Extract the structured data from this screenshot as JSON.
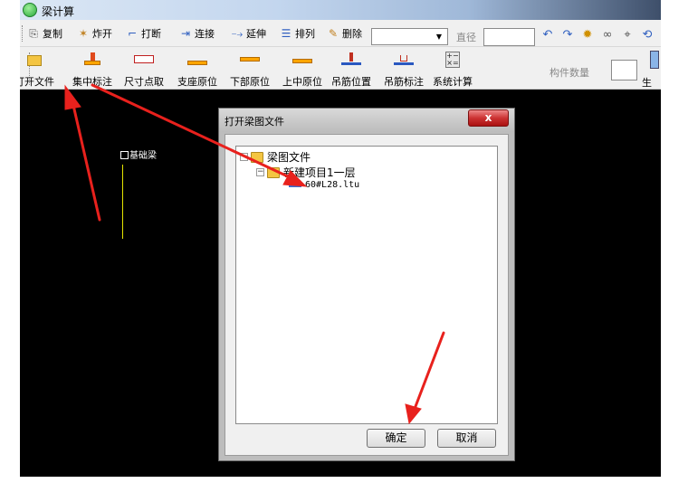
{
  "titlebar": {
    "title": "梁计算"
  },
  "toolbar1": {
    "copy": "复制",
    "explode": "炸开",
    "break": "打断",
    "connect": "连接",
    "extend": "延伸",
    "arrange": "排列",
    "delete": "删除",
    "combo_value": "",
    "diameter_label": "直径",
    "diameter_value": ""
  },
  "toolbar2": {
    "open_file": "打开文件",
    "concentrated_mark": "集中标注",
    "dimension_point": "尺寸点取",
    "support_origin": "支座原位",
    "bottom_origin": "下部原位",
    "top_middle_origin": "上中原位",
    "hanger_position": "吊筋位置",
    "hanger_mark": "吊筋标注",
    "system_calc": "系统计算",
    "member_count_label": "构件数量",
    "member_count_value": "",
    "generate": "生成"
  },
  "canvas": {
    "beam_label": "基础梁"
  },
  "dialog": {
    "title": "打开梁图文件",
    "close": "x",
    "tree": {
      "root": "梁图文件",
      "project": "新建项目1一层",
      "file": "60#L28.ltu"
    },
    "ok": "确定",
    "cancel": "取消"
  },
  "colors": {
    "annotation_arrow": "#e8211d",
    "canvas_bg": "#000000",
    "beam_line": "#e6e600"
  }
}
